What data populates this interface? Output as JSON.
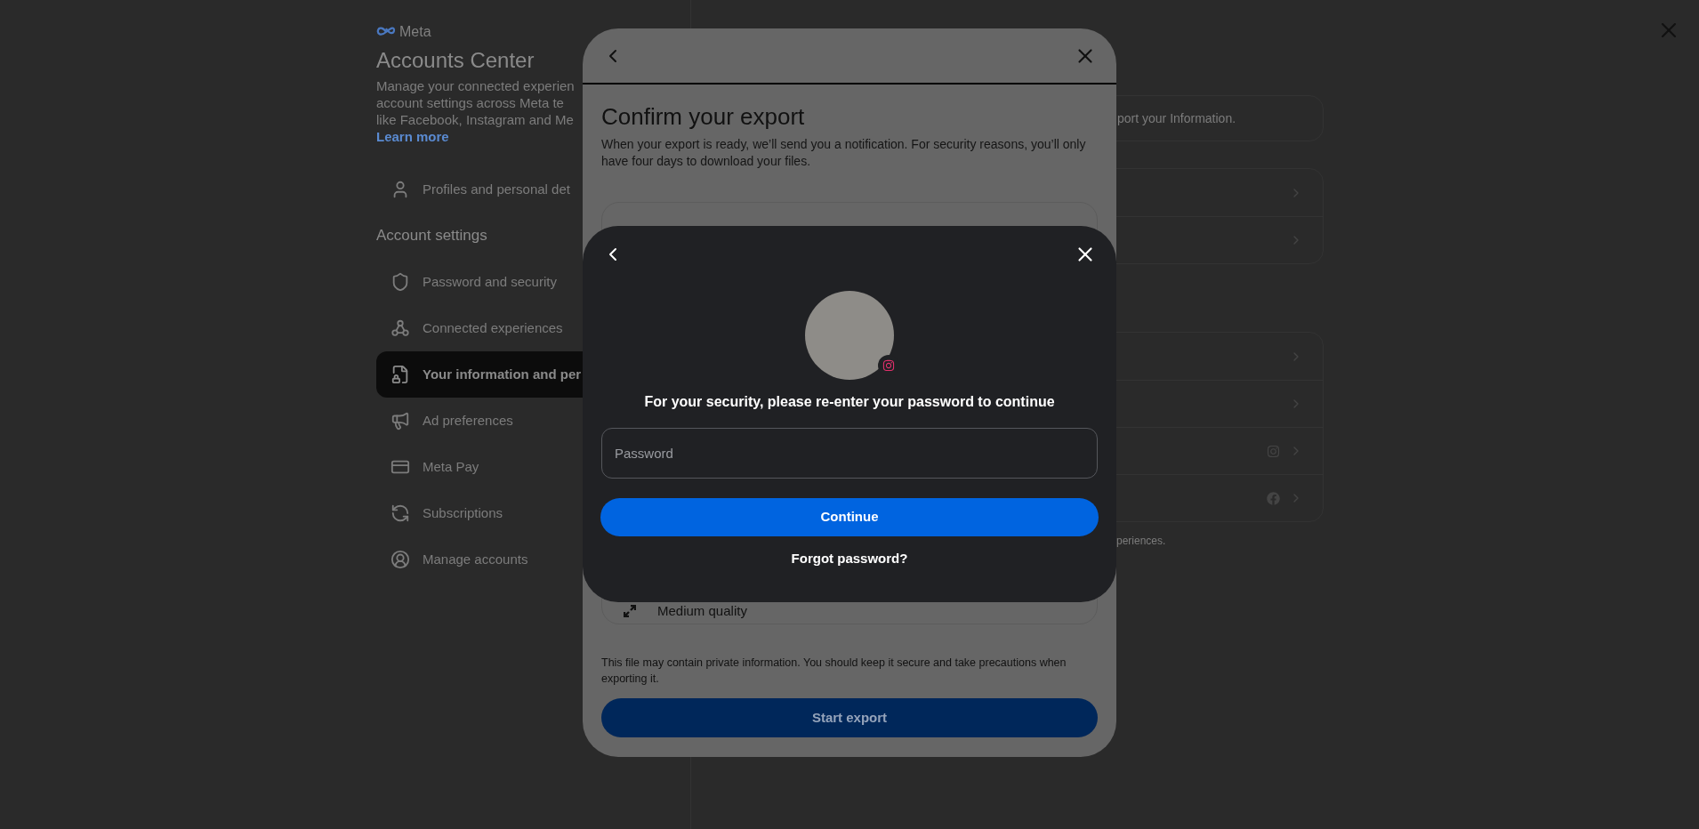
{
  "sidebar": {
    "brand": "Meta",
    "title": "Accounts Center",
    "description_lines": [
      "Manage your connected experien",
      "account settings across Meta te",
      "like Facebook, Instagram and Me"
    ],
    "learn_more": "Learn more",
    "profiles_item": {
      "label": "Profiles and personal det",
      "selected": false
    },
    "section_title": "Account settings",
    "items": [
      {
        "label": "Password and security",
        "selected": false
      },
      {
        "label": "Connected experiences",
        "selected": false
      },
      {
        "label": "Your information and per",
        "selected": true
      },
      {
        "label": "Ad preferences",
        "selected": false
      },
      {
        "label": "Meta Pay",
        "selected": false
      },
      {
        "label": "Subscriptions",
        "selected": false
      },
      {
        "label": "Manage accounts",
        "selected": false
      }
    ]
  },
  "main": {
    "notice": "port your Information.",
    "groups": [
      {
        "rows": [
          {
            "kind": "plain"
          },
          {
            "kind": "plain"
          }
        ]
      },
      {
        "rows": [
          {
            "kind": "plain"
          },
          {
            "kind": "plain"
          },
          {
            "kind": "instagram"
          },
          {
            "kind": "facebook"
          }
        ]
      }
    ],
    "footer": "periences."
  },
  "export_dialog": {
    "title": "Confirm your export",
    "description": "When your export is ready, we’ll send you a notification. For security reasons, you’ll only have four days to download your files.",
    "option": {
      "subtitle": "Medium quality"
    },
    "disclaimer": "This file may contain private information. You should keep it secure and take precautions when exporting it.",
    "button": {
      "label": "Start export",
      "disabled": true
    }
  },
  "password_dialog": {
    "heading": "For your security, please re-enter your password to continue",
    "password_field": {
      "placeholder": "Password"
    },
    "continue_button": "Continue",
    "forgot_link": "Forgot password?"
  }
}
